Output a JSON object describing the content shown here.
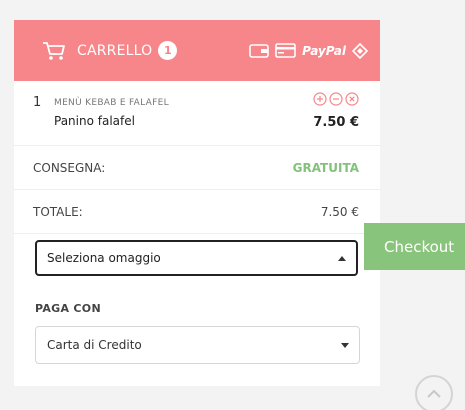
{
  "cart": {
    "title": "CARRELLO",
    "count": "1",
    "payment_icons": [
      "wallet-icon",
      "credit-card-icon",
      "paypal-icon",
      "ticket-icon"
    ],
    "paypal_text": "PayPal"
  },
  "item": {
    "qty": "1",
    "category": "MENÙ KEBAB E FALAFEL",
    "name": "Panino falafel",
    "price": "7.50 €",
    "actions": [
      "plus-circle-icon",
      "minus-circle-icon",
      "close-circle-icon"
    ]
  },
  "delivery": {
    "label": "CONSEGNA:",
    "value": "GRATUITA"
  },
  "total": {
    "label": "TOTALE:",
    "value": "7.50 €"
  },
  "gift_select": {
    "value": "Seleziona omaggio"
  },
  "pay_with": {
    "label": "PAGA CON",
    "value": "Carta di Credito"
  },
  "checkout_label": "Checkout",
  "colors": {
    "header": "#f7868a",
    "free": "#82c27a",
    "checkout": "#89c47c"
  }
}
